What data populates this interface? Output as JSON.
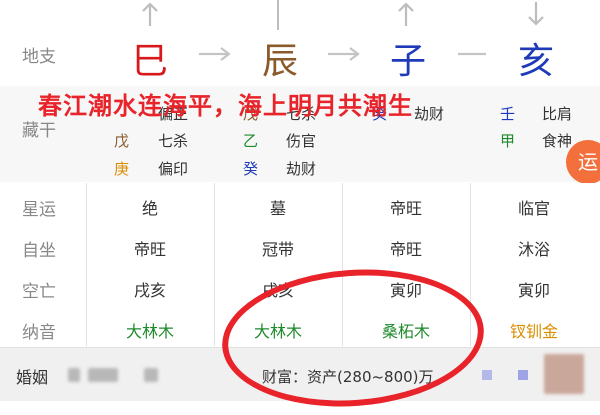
{
  "branches_label": "地支",
  "branches": [
    {
      "char": "巳",
      "color": "#d7191c"
    },
    {
      "char": "辰",
      "color": "#8b5a2b"
    },
    {
      "char": "子",
      "color": "#1e3ab8"
    },
    {
      "char": "亥",
      "color": "#1e3ab8"
    }
  ],
  "caption": "春江潮水连海平，海上明月共潮生",
  "hidden_label": "藏干",
  "hidden_stems": {
    "col1": [
      {
        "stem": "",
        "name": "偏正",
        "color": "#d98e00"
      },
      {
        "stem": "戊",
        "name": "七杀",
        "color": "#8b5a2b"
      },
      {
        "stem": "庚",
        "name": "偏印",
        "color": "#d98e00"
      }
    ],
    "col2": [
      {
        "stem": "戊",
        "name": "七杀",
        "color": "#8b5a2b"
      },
      {
        "stem": "乙",
        "name": "伤官",
        "color": "#1f8a2c"
      },
      {
        "stem": "癸",
        "name": "劫财",
        "color": "#1e3ab8"
      }
    ],
    "col3": [
      {
        "stem": "癸",
        "name": "劫财",
        "color": "#1e3ab8"
      }
    ],
    "col4": [
      {
        "stem": "壬",
        "name": "比肩",
        "color": "#1e3ab8"
      },
      {
        "stem": "甲",
        "name": "食神",
        "color": "#1f8a2c"
      }
    ]
  },
  "rows": [
    {
      "label": "星运",
      "values": [
        "绝",
        "墓",
        "帝旺",
        "临官"
      ]
    },
    {
      "label": "自坐",
      "values": [
        "帝旺",
        "冠带",
        "帝旺",
        "沐浴"
      ]
    },
    {
      "label": "空亡",
      "values": [
        "戌亥",
        "戌亥",
        "寅卯",
        "寅卯"
      ]
    },
    {
      "label": "纳音",
      "values": [
        "大林木",
        "大林木",
        "桑柘木",
        "钗钏金"
      ]
    }
  ],
  "fab_label": "运",
  "bottom": {
    "marriage_label": "婚姻",
    "wealth_label": "财富：资产(280~800)万"
  }
}
